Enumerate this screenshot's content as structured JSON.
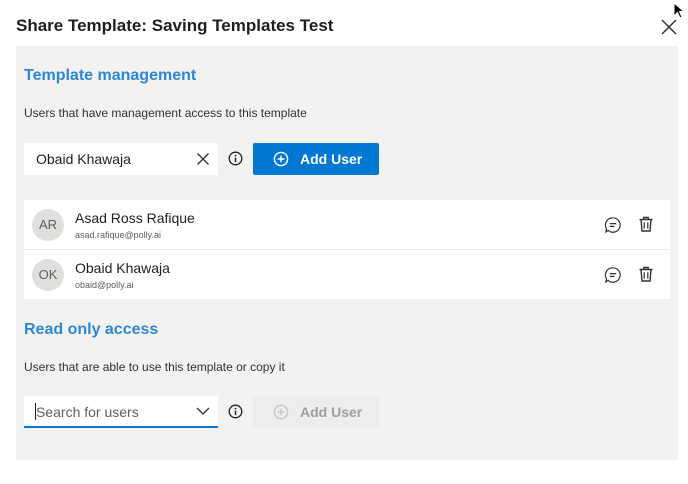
{
  "dialog": {
    "title": "Share Template: Saving Templates Test",
    "close_icon": "close-icon"
  },
  "management": {
    "title": "Template management",
    "description": "Users that have management access to this template",
    "input_value": "Obaid Khawaja",
    "add_button_label": "Add User",
    "users": [
      {
        "initials": "AR",
        "name": "Asad Ross Rafique",
        "email": "asad.rafique@polly.ai"
      },
      {
        "initials": "OK",
        "name": "Obaid Khawaja",
        "email": "obaid@polly.ai"
      }
    ]
  },
  "readonly": {
    "title": "Read only access",
    "description": "Users that are able to use this template or copy it",
    "search_placeholder": "Search for users",
    "add_button_label": "Add User"
  },
  "colors": {
    "accent": "#0078d4",
    "section_title": "#2b88d8",
    "panel_bg": "#f3f2f1"
  }
}
